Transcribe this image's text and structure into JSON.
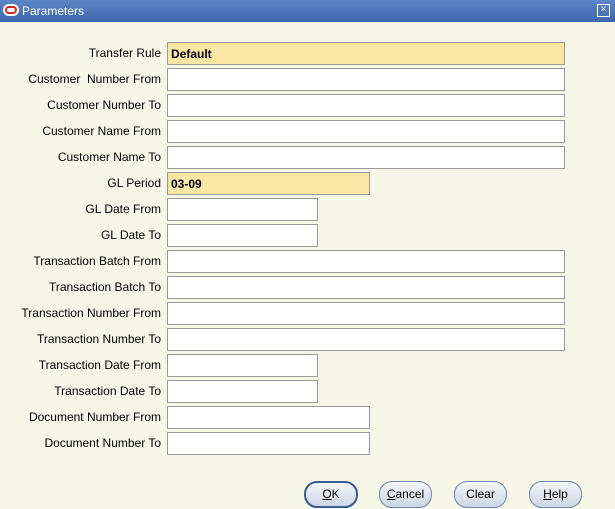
{
  "window": {
    "title": "Parameters",
    "close_glyph": "×"
  },
  "icons": {
    "title_logo": "oracle-logo-icon",
    "close": "close-icon"
  },
  "colors": {
    "titlebar": "#4a74b8",
    "background": "#f7f7e7",
    "required_field": "#fbe6a4"
  },
  "fields": [
    {
      "label": "Transfer Rule",
      "value": "Default",
      "required": true
    },
    {
      "label": "Customer  Number From",
      "value": ""
    },
    {
      "label": "Customer Number To",
      "value": ""
    },
    {
      "label": "Customer Name From",
      "value": ""
    },
    {
      "label": "Customer Name To",
      "value": ""
    },
    {
      "label": "GL Period",
      "value": "03-09",
      "required": true
    },
    {
      "label": "GL Date From",
      "value": ""
    },
    {
      "label": "GL Date To",
      "value": ""
    },
    {
      "label": "Transaction Batch From",
      "value": ""
    },
    {
      "label": "Transaction Batch To",
      "value": ""
    },
    {
      "label": "Transaction Number From",
      "value": ""
    },
    {
      "label": "Transaction Number To",
      "value": ""
    },
    {
      "label": "Transaction Date From",
      "value": ""
    },
    {
      "label": "Transaction Date To",
      "value": ""
    },
    {
      "label": "Document Number From",
      "value": ""
    },
    {
      "label": "Document Number To",
      "value": ""
    }
  ],
  "buttons": {
    "ok": {
      "mnemonic": "O",
      "rest": "K"
    },
    "cancel": {
      "mnemonic": "C",
      "rest": "ancel"
    },
    "clear": {
      "label": "Clear"
    },
    "help": {
      "mnemonic": "H",
      "rest": "elp"
    }
  }
}
